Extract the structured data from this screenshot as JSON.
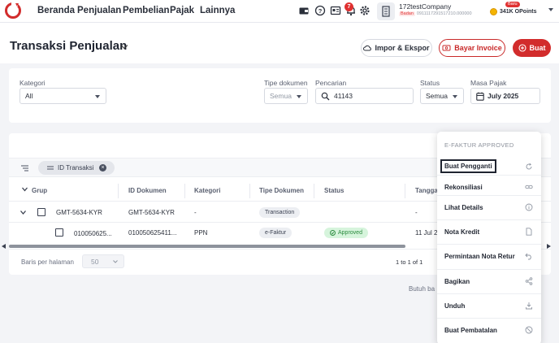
{
  "nav": {
    "items": [
      "Beranda",
      "Penjualan",
      "Pembelian",
      "Pajak",
      "Lainnya"
    ],
    "notif_count": "7",
    "company_name": "172testCompany",
    "company_tag": "Badan",
    "company_npwp": "0911117291517210.000000",
    "points": "341K OPoints",
    "baru_badge": "Baru"
  },
  "header": {
    "title": "Transaksi Penjualan",
    "import_label": "Impor & Ekspor",
    "bayar_label": "Bayar Invoice",
    "buat_label": "Buat"
  },
  "filters": {
    "kategori_label": "Kategori",
    "kategori_value": "All",
    "tipe_label": "Tipe dokumen",
    "tipe_value": "Semua",
    "pencarian_label": "Pencarian",
    "pencarian_value": "41143",
    "status_label": "Status",
    "status_value": "Semua",
    "masa_label": "Masa Pajak",
    "masa_value": "July 2025"
  },
  "table": {
    "chip_label": "ID Transaksi",
    "columns": [
      "Grup",
      "ID Dokumen",
      "Kategori",
      "Tipe Dokumen",
      "Status",
      "Tangga"
    ],
    "group_row": {
      "grup": "GMT-5634-KYR",
      "id_dokumen": "GMT-5634-KYR",
      "kategori": "-",
      "tipe": "Transaction",
      "tanggal": "-"
    },
    "child_row": {
      "grup": "010050625...",
      "id_dokumen": "010050625411...",
      "kategori": "PPN",
      "tipe": "e-Faktur",
      "status": "Approved",
      "tanggal": "11 Jul 20"
    },
    "rows_per_page_label": "Baris per halaman",
    "rows_per_page_value": "50",
    "pagination": "1 to 1 of 1",
    "butuh_label": "Butuh ba"
  },
  "menu": {
    "header": "E-FAKTUR APPROVED",
    "items": [
      {
        "label": "Buat Pengganti",
        "icon": "refresh-icon"
      },
      {
        "label": "Rekonsiliasi",
        "icon": "link-icon"
      },
      {
        "label": "Lihat Details",
        "icon": "info-icon"
      },
      {
        "label": "Nota Kredit",
        "icon": "document-icon"
      },
      {
        "label": "Permintaan Nota Retur",
        "icon": "return-icon"
      },
      {
        "label": "Bagikan",
        "icon": "share-icon"
      },
      {
        "label": "Unduh",
        "icon": "download-icon"
      },
      {
        "label": "Buat Pembatalan",
        "icon": "cancel-icon"
      }
    ]
  },
  "colors": {
    "accent": "#d22c2c",
    "approved": "#2a8b3e"
  }
}
